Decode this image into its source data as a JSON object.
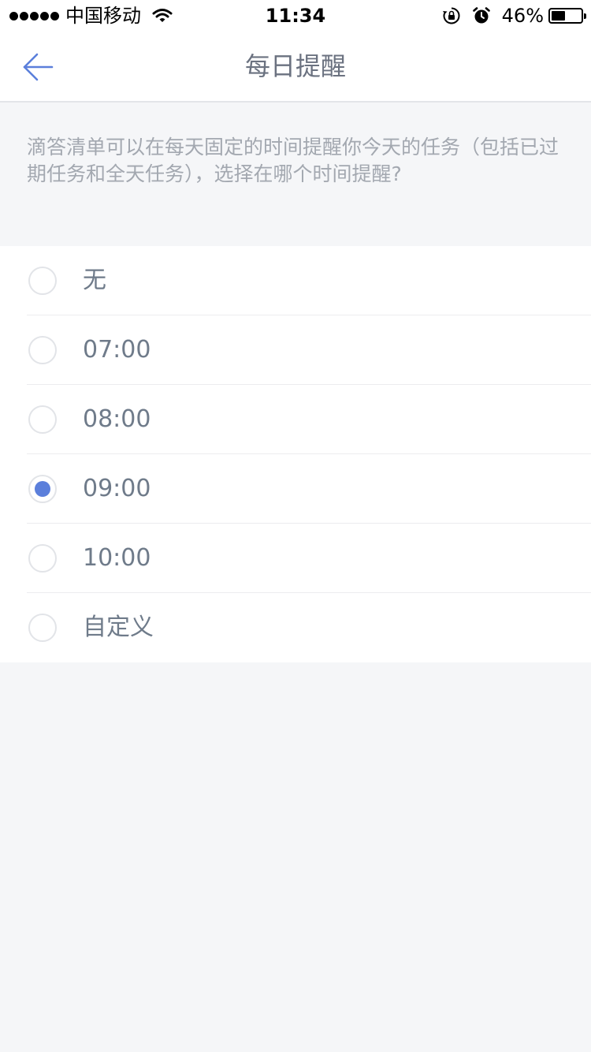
{
  "status_bar": {
    "carrier": "中国移动",
    "time": "11:34",
    "battery_percent": "46%",
    "battery_level": 0.46,
    "icons": [
      "signal-dots-icon",
      "wifi-icon",
      "rotation-lock-icon",
      "alarm-icon",
      "battery-icon"
    ]
  },
  "nav": {
    "title": "每日提醒",
    "back_icon": "arrow-left-icon"
  },
  "description": "滴答清单可以在每天固定的时间提醒你今天的任务（包括已过期任务和全天任务），选择在哪个时间提醒?",
  "options": [
    {
      "label": "无",
      "selected": false
    },
    {
      "label": "07:00",
      "selected": false
    },
    {
      "label": "08:00",
      "selected": false
    },
    {
      "label": "09:00",
      "selected": true
    },
    {
      "label": "10:00",
      "selected": false
    },
    {
      "label": "自定义",
      "selected": false
    }
  ],
  "colors": {
    "accent": "#5b7fdb",
    "title": "#6b7280",
    "description": "#a3a8b0",
    "background": "#f5f6f8"
  }
}
